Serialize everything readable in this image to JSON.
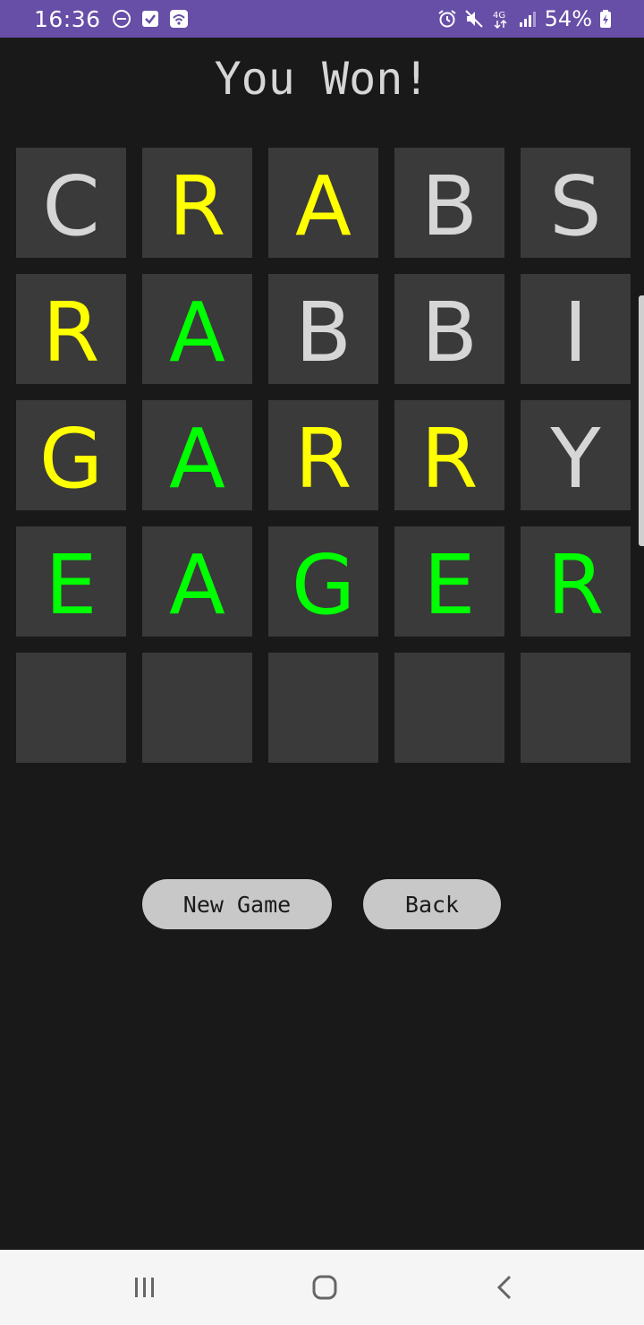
{
  "status_bar": {
    "time": "16:36",
    "battery": "54%",
    "network": "4G",
    "left_icons": [
      "do-not-disturb-icon",
      "task-check-icon",
      "wifi-calling-icon"
    ],
    "right_icons": [
      "alarm-icon",
      "mute-icon",
      "network-4g-icon",
      "signal-icon",
      "battery-icon"
    ],
    "color": "#674ea7"
  },
  "game": {
    "title": "You Won!",
    "colors": {
      "absent": "#d6d6d6",
      "present": "#ffff00",
      "correct": "#00ff00",
      "tile_bg": "#3a3a3a"
    },
    "rows": [
      [
        {
          "letter": "C",
          "state": "absent"
        },
        {
          "letter": "R",
          "state": "present"
        },
        {
          "letter": "A",
          "state": "present"
        },
        {
          "letter": "B",
          "state": "absent"
        },
        {
          "letter": "S",
          "state": "absent"
        }
      ],
      [
        {
          "letter": "R",
          "state": "present"
        },
        {
          "letter": "A",
          "state": "correct"
        },
        {
          "letter": "B",
          "state": "absent"
        },
        {
          "letter": "B",
          "state": "absent"
        },
        {
          "letter": "I",
          "state": "absent"
        }
      ],
      [
        {
          "letter": "G",
          "state": "present"
        },
        {
          "letter": "A",
          "state": "correct"
        },
        {
          "letter": "R",
          "state": "present"
        },
        {
          "letter": "R",
          "state": "present"
        },
        {
          "letter": "Y",
          "state": "absent"
        }
      ],
      [
        {
          "letter": "E",
          "state": "correct"
        },
        {
          "letter": "A",
          "state": "correct"
        },
        {
          "letter": "G",
          "state": "correct"
        },
        {
          "letter": "E",
          "state": "correct"
        },
        {
          "letter": "R",
          "state": "correct"
        }
      ],
      [
        {
          "letter": "",
          "state": "empty"
        },
        {
          "letter": "",
          "state": "empty"
        },
        {
          "letter": "",
          "state": "empty"
        },
        {
          "letter": "",
          "state": "empty"
        },
        {
          "letter": "",
          "state": "empty"
        }
      ]
    ]
  },
  "buttons": {
    "new_game": "New Game",
    "back": "Back"
  },
  "nav_bar": {
    "items": [
      "recents-icon",
      "home-icon",
      "back-icon"
    ]
  }
}
